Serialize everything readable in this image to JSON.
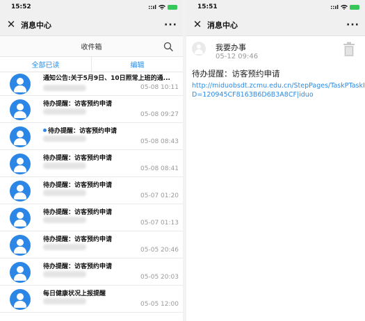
{
  "left": {
    "status_time": "15:52",
    "status_signal": "::ıl",
    "nav_title": "消息中心",
    "nav_more": "···",
    "inbox_label": "收件箱",
    "tabs": [
      "全部已读",
      "编辑"
    ],
    "messages": [
      {
        "title": "通知公告:关于5月9日、10日照常上班的通...",
        "time": "05-08 10:11",
        "unread": false
      },
      {
        "title": "待办提醒：访客预约申请",
        "time": "05-08 09:27",
        "unread": false
      },
      {
        "title": "待办提醒：访客预约申请",
        "time": "05-08 08:43",
        "unread": true
      },
      {
        "title": "待办提醒：访客预约申请",
        "time": "05-08 08:41",
        "unread": false
      },
      {
        "title": "待办提醒：访客预约申请",
        "time": "05-07 01:20",
        "unread": false
      },
      {
        "title": "待办提醒：访客预约申请",
        "time": "05-07 01:13",
        "unread": false
      },
      {
        "title": "待办提醒：访客预约申请",
        "time": "05-05 20:46",
        "unread": false
      },
      {
        "title": "待办提醒：访客预约申请",
        "time": "05-05 20:03",
        "unread": false
      },
      {
        "title": "每日健康状况上报提醒",
        "time": "05-05 12:00",
        "unread": false
      }
    ],
    "colors": {
      "accent": "#2a8be4",
      "avatar": "#2b86e6",
      "battery": "#35c759"
    }
  },
  "right": {
    "status_time": "15:51",
    "status_signal": "::ıl",
    "nav_title": "消息中心",
    "nav_more": "···",
    "sender": "我要办事",
    "time": "05-12 09:46",
    "title": "待办提醒：访客预约申请",
    "link": "http://miduobsdt.zcmu.edu.cn/StepPages/TaskPTaskID=120945CF8163B6D6B3A8CF|iduo"
  }
}
